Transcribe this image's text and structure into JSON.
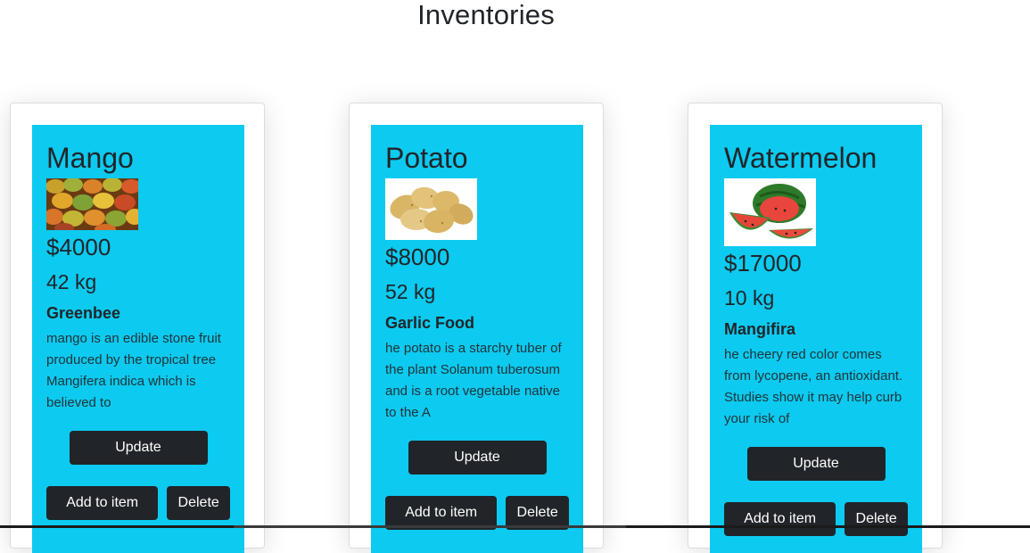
{
  "page": {
    "title": "Inventories"
  },
  "items": [
    {
      "name": "Mango",
      "image_icon": "mango-photo",
      "price": "$4000",
      "quantity": "42 kg",
      "supplier": "Greenbee",
      "description": "mango is an edible stone fruit produced by the tropical tree Mangifera indica which is believed to",
      "update_label": "Update",
      "add_label": "Add to item",
      "delete_label": "Delete"
    },
    {
      "name": "Potato",
      "image_icon": "potato-photo",
      "price": "$8000",
      "quantity": "52 kg",
      "supplier": "Garlic Food",
      "description": "he potato is a starchy tuber of the plant Solanum tuberosum and is a root vegetable native to the A",
      "update_label": "Update",
      "add_label": "Add to item",
      "delete_label": "Delete"
    },
    {
      "name": "Watermelon",
      "image_icon": "watermelon-photo",
      "price": "$17000",
      "quantity": "10 kg",
      "supplier": "Mangifira",
      "description": "he cheery red color comes from lycopene, an antioxidant. Studies show it may help curb your risk of",
      "update_label": "Update",
      "add_label": "Add to item",
      "delete_label": "Delete"
    }
  ],
  "colors": {
    "card_accent": "#0dcaf0",
    "button_bg": "#212529",
    "button_text": "#ffffff"
  }
}
